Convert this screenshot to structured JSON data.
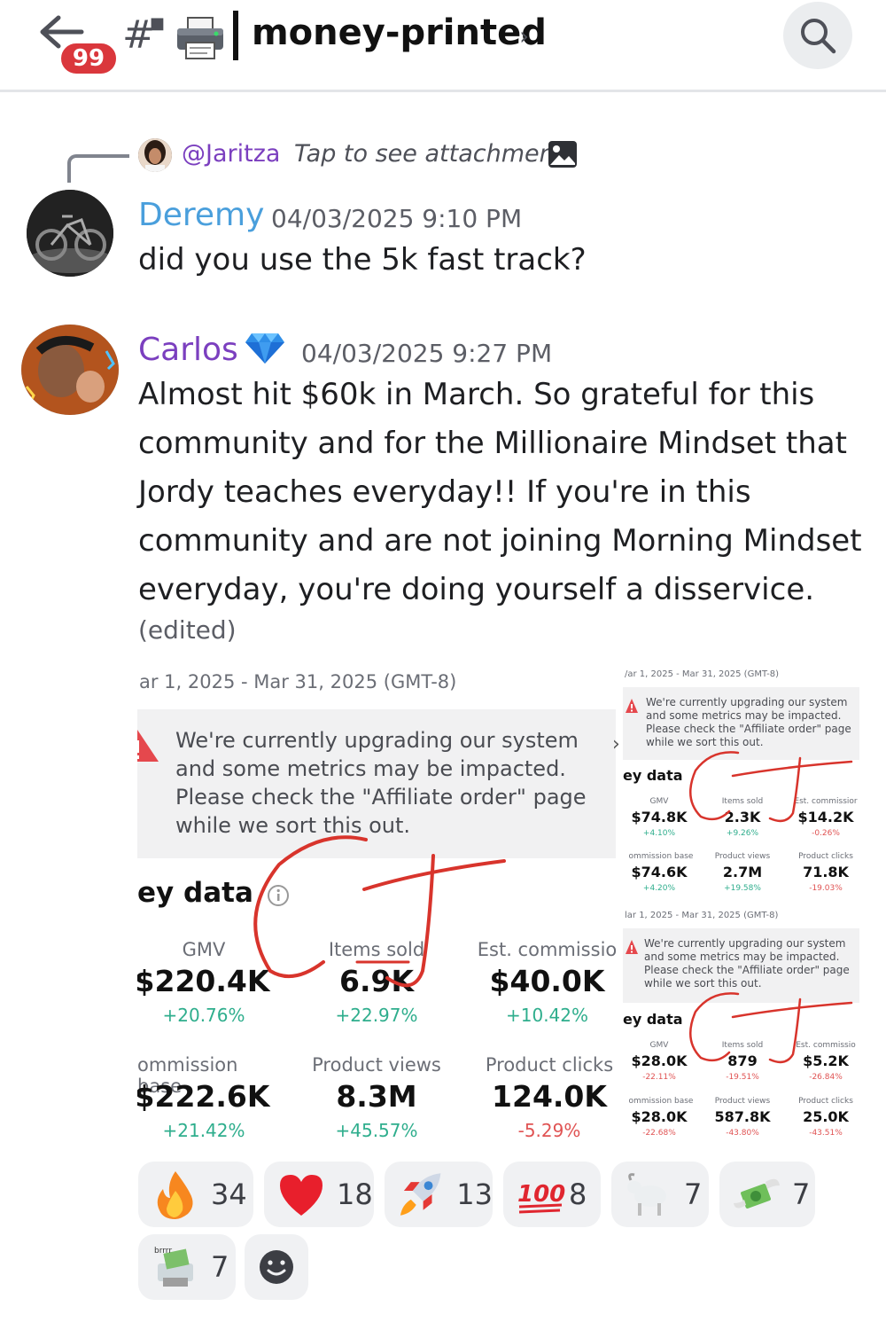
{
  "header": {
    "unread_badge": "99",
    "channel_name": "money-printed"
  },
  "reply": {
    "username": "@Jaritza",
    "text": "Tap to see attachment"
  },
  "messages": [
    {
      "author": "Deremy",
      "author_color": "#4a9fdc",
      "timestamp": "04/03/2025 9:10 PM",
      "lines": [
        "did you use the 5k fast track?"
      ]
    },
    {
      "author": "Carlos",
      "author_color": "#7b3fbf",
      "timestamp": "04/03/2025 9:27 PM",
      "lines": [
        "Almost hit $60k in March. So grateful for this",
        "community and for the Millionaire Mindset that",
        "Jordy teaches everyday!! If you're in this",
        "community and are not joining Morning Mindset",
        "everyday, you're doing yourself a disservice."
      ],
      "edited": "(edited)"
    }
  ],
  "attachment": {
    "main": {
      "date_range": "ar 1, 2025 - Mar 31, 2025 (GMT-8)",
      "warning": [
        "We're currently upgrading our system",
        "and some metrics may be impacted.",
        "Please check the \"Affiliate order\" page",
        "while we sort this out."
      ],
      "key_data": "ey data",
      "metrics": [
        {
          "label": "GMV",
          "value": "$220.4K",
          "change": "+20.76%"
        },
        {
          "label": "Items sold",
          "value": "6.9K",
          "change": "+22.97%"
        },
        {
          "label": "Est. commissio",
          "value": "$40.0K",
          "change": "+10.42%"
        },
        {
          "label": "ommission base",
          "value": "$222.6K",
          "change": "+21.42%"
        },
        {
          "label": "Product views",
          "value": "8.3M",
          "change": "+45.57%"
        },
        {
          "label": "Product clicks",
          "value": "124.0K",
          "change": "-5.29%"
        }
      ]
    },
    "side_top": {
      "date_range": "/ar 1, 2025 - Mar 31, 2025 (GMT-8)",
      "warning": [
        "We're currently upgrading our system",
        "and some metrics may be impacted.",
        "Please check the \"Affiliate order\" page",
        "while we sort this out."
      ],
      "key_data": "ey data",
      "metrics": [
        {
          "label": "GMV",
          "value": "$74.8K",
          "change": "+4.10%"
        },
        {
          "label": "Items sold",
          "value": "2.3K",
          "change": "+9.26%"
        },
        {
          "label": "Est. commissior",
          "value": "$14.2K",
          "change": "-0.26%"
        },
        {
          "label": "ommission base",
          "value": "$74.6K",
          "change": "+4.20%"
        },
        {
          "label": "Product views",
          "value": "2.7M",
          "change": "+19.58%"
        },
        {
          "label": "Product clicks",
          "value": "71.8K",
          "change": "-19.03%"
        }
      ]
    },
    "side_bottom": {
      "date_range": "lar 1, 2025 - Mar 31, 2025 (GMT-8)",
      "warning": [
        "We're currently upgrading our system",
        "and some metrics may be impacted.",
        "Please check the \"Affiliate order\" page",
        "while we sort this out."
      ],
      "key_data": "ey data",
      "metrics": [
        {
          "label": "GMV",
          "value": "$28.0K",
          "change": "-22.11%"
        },
        {
          "label": "Items sold",
          "value": "879",
          "change": "-19.51%"
        },
        {
          "label": "Est. commissio",
          "value": "$5.2K",
          "change": "-26.84%"
        },
        {
          "label": "ommission base",
          "value": "$28.0K",
          "change": "-22.68%"
        },
        {
          "label": "Product views",
          "value": "587.8K",
          "change": "-43.80%"
        },
        {
          "label": "Product clicks",
          "value": "25.0K",
          "change": "-43.51%"
        }
      ]
    }
  },
  "reactions": [
    {
      "emoji": "fire-emoji",
      "count": "34"
    },
    {
      "emoji": "heart-emoji",
      "count": "18"
    },
    {
      "emoji": "rocket-emoji",
      "count": "13"
    },
    {
      "emoji": "hundred-points-emoji",
      "count": "8"
    },
    {
      "emoji": "goat-emoji",
      "count": "7"
    },
    {
      "emoji": "money-with-wings-emoji",
      "count": "7"
    },
    {
      "emoji": "money-printer-emoji",
      "count": "7"
    }
  ]
}
